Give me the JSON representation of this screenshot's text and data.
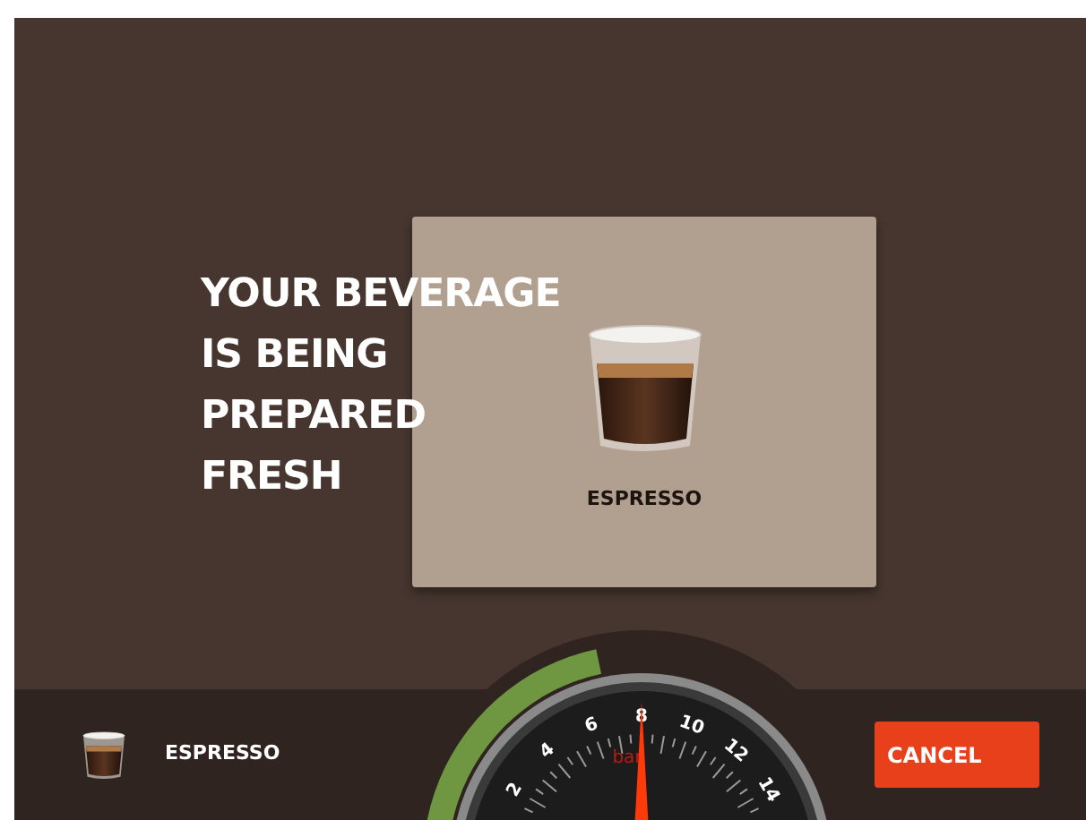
{
  "headline": [
    "YOUR BEVERAGE",
    "IS BEING",
    "PREPARED",
    "FRESH"
  ],
  "card": {
    "beverage": "ESPRESSO"
  },
  "bottom_bar": {
    "beverage": "ESPRESSO",
    "cancel_button": "CANCEL"
  },
  "gauge": {
    "unit": "bar",
    "scale": [
      "2",
      "4",
      "6",
      "8",
      "10",
      "12",
      "14"
    ],
    "level": 0.5
  }
}
